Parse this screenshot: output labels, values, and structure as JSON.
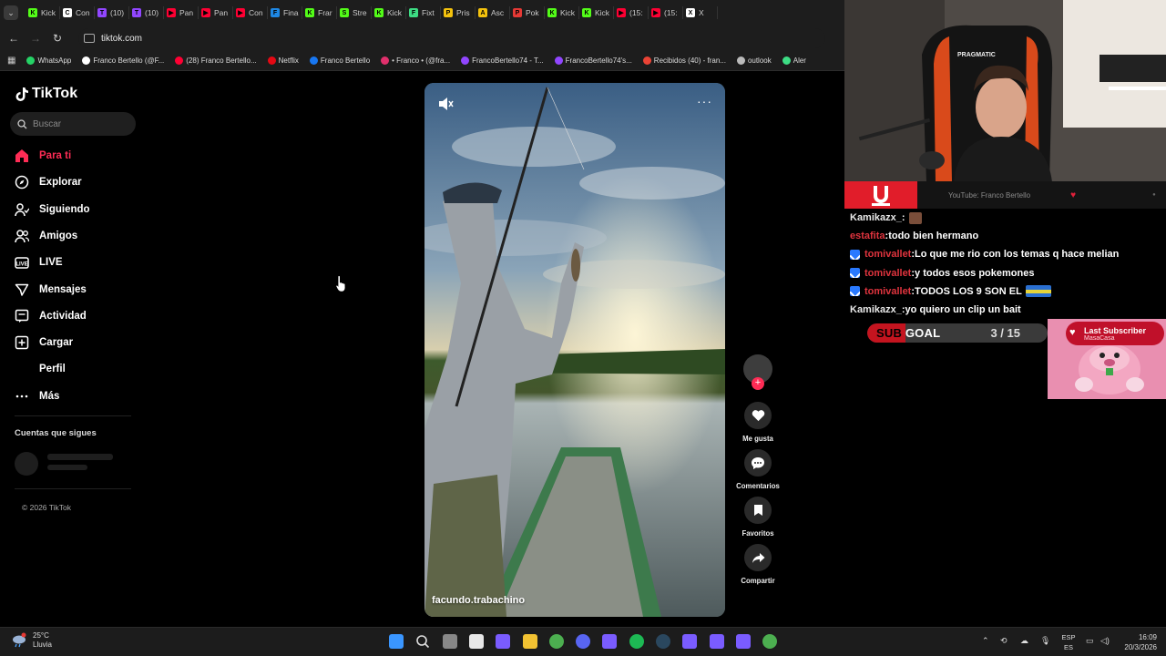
{
  "browser": {
    "tabs": [
      {
        "label": "Kick",
        "color": "#53fc18",
        "letter": "K"
      },
      {
        "label": "Con",
        "color": "#ffffff",
        "letter": "C"
      },
      {
        "label": "(10)",
        "color": "#9146ff",
        "letter": "T"
      },
      {
        "label": "(10)",
        "color": "#9146ff",
        "letter": "T"
      },
      {
        "label": "Pan",
        "color": "#ff0033",
        "letter": "▶"
      },
      {
        "label": "Pan",
        "color": "#ff0033",
        "letter": "▶"
      },
      {
        "label": "Con",
        "color": "#ff0033",
        "letter": "▶"
      },
      {
        "label": "Fina",
        "color": "#1e88e5",
        "letter": "F"
      },
      {
        "label": "Frar",
        "color": "#53fc18",
        "letter": "K"
      },
      {
        "label": "Stre",
        "color": "#53fc18",
        "letter": "S"
      },
      {
        "label": "Kick",
        "color": "#53fc18",
        "letter": "K"
      },
      {
        "label": "Fixt",
        "color": "#3ddc84",
        "letter": "F"
      },
      {
        "label": "Pris",
        "color": "#f4c20d",
        "letter": "P"
      },
      {
        "label": "Asc",
        "color": "#f4c20d",
        "letter": "A"
      },
      {
        "label": "Pok",
        "color": "#e53935",
        "letter": "P"
      },
      {
        "label": "Kick",
        "color": "#53fc18",
        "letter": "K"
      },
      {
        "label": "Kick",
        "color": "#53fc18",
        "letter": "K"
      },
      {
        "label": "(15:",
        "color": "#ff0033",
        "letter": "▶"
      },
      {
        "label": "(15:",
        "color": "#ff0033",
        "letter": "▶"
      },
      {
        "label": "X",
        "color": "#ffffff",
        "letter": "X"
      }
    ],
    "url": "tiktok.com",
    "bookmarks": [
      {
        "label": "WhatsApp",
        "color": "#25d366"
      },
      {
        "label": "Franco Bertello (@F...",
        "color": "#ffffff"
      },
      {
        "label": "(28) Franco Bertello...",
        "color": "#ff0033"
      },
      {
        "label": "Netflix",
        "color": "#e50914"
      },
      {
        "label": "Franco Bertello",
        "color": "#1877f2"
      },
      {
        "label": "• Franco • (@fra...",
        "color": "#e1306c"
      },
      {
        "label": "FrancoBertello74 - T...",
        "color": "#9146ff"
      },
      {
        "label": "FrancoBertello74's...",
        "color": "#9146ff"
      },
      {
        "label": "Recibidos (40) - fran...",
        "color": "#ea4335"
      },
      {
        "label": "outlook",
        "color": "#bbbbbb"
      },
      {
        "label": "Aler",
        "color": "#3ddc84"
      }
    ]
  },
  "tiktok": {
    "logo": "TikTok",
    "search_placeholder": "Buscar",
    "nav": [
      {
        "label": "Para ti",
        "icon": "home-icon"
      },
      {
        "label": "Explorar",
        "icon": "compass-icon"
      },
      {
        "label": "Siguiendo",
        "icon": "following-icon"
      },
      {
        "label": "Amigos",
        "icon": "friends-icon"
      },
      {
        "label": "LIVE",
        "icon": "live-icon"
      },
      {
        "label": "Mensajes",
        "icon": "messages-icon"
      },
      {
        "label": "Actividad",
        "icon": "activity-icon"
      },
      {
        "label": "Cargar",
        "icon": "upload-icon"
      },
      {
        "label": "Perfil",
        "icon": "profile-icon"
      },
      {
        "label": "Más",
        "icon": "more-icon"
      }
    ],
    "following_title": "Cuentas que sigues",
    "copyright": "© 2026 TikTok",
    "video": {
      "username": "facundo.trabachino"
    },
    "actions": {
      "like": "Me gusta",
      "comments": "Comentarios",
      "favorites": "Favoritos",
      "share": "Compartir"
    }
  },
  "stream": {
    "youtube_label": "YouTube: Franco Bertello",
    "chat": [
      {
        "user": "Kamikazx_",
        "text": "",
        "style": "white",
        "badge": false,
        "emote": "single"
      },
      {
        "user": "estafita",
        "text": "todo bien hermano",
        "style": "red",
        "badge": false,
        "emote": ""
      },
      {
        "user": "tomivallet",
        "text": "Lo que me rio con los temas q hace melian",
        "style": "red",
        "badge": true,
        "emote": ""
      },
      {
        "user": "tomivallet",
        "text": "y todos esos pokemones",
        "style": "red",
        "badge": true,
        "emote": ""
      },
      {
        "user": "tomivallet",
        "text": "TODOS LOS 9 SON EL",
        "style": "red",
        "badge": true,
        "emote": "wide"
      },
      {
        "user": "Kamikazx_",
        "text": "yo quiero un clip un bait",
        "style": "white",
        "badge": false,
        "emote": ""
      }
    ],
    "subgoal": {
      "label_a": "SUB",
      "label_b": "GOAL",
      "count": "3 / 15",
      "current": 3,
      "target": 15
    },
    "last_subscriber": {
      "title": "Last Subscriber",
      "name": "MasaCasa"
    }
  },
  "taskbar": {
    "temperature": "25°C",
    "weather": "Lluvia",
    "lang_a": "ESP",
    "lang_b": "ES",
    "time": "16:09",
    "date": "20/3/2026",
    "apps": [
      "start-icon",
      "search-icon",
      "task-view-icon",
      "store-icon",
      "app-icon",
      "file-explorer-icon",
      "chrome-icon",
      "discord-icon",
      "app-icon",
      "spotify-icon",
      "steam-icon",
      "app-icon",
      "app-icon",
      "app-icon",
      "chrome-icon"
    ]
  }
}
